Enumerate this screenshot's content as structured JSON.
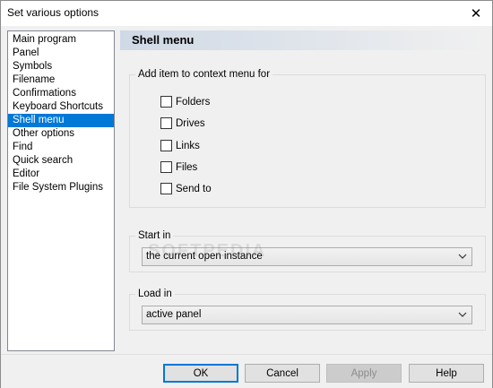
{
  "window": {
    "title": "Set various options"
  },
  "nav": {
    "items": [
      "Main program",
      "Panel",
      "Symbols",
      "Filename",
      "Confirmations",
      "Keyboard Shortcuts",
      "Shell menu",
      "Other options",
      "Find",
      "Quick search",
      "Editor",
      "File System Plugins"
    ],
    "selected": "Shell menu"
  },
  "panel": {
    "title": "Shell menu"
  },
  "context_group": {
    "legend": "Add  item to context menu for",
    "options": [
      {
        "label": "Folders",
        "checked": false
      },
      {
        "label": "Drives",
        "checked": false
      },
      {
        "label": "Links",
        "checked": false
      },
      {
        "label": "Files",
        "checked": false
      },
      {
        "label": "Send to",
        "checked": false
      }
    ]
  },
  "start_in": {
    "legend": "Start in",
    "value": "the current open instance"
  },
  "load_in": {
    "legend": "Load in",
    "value": "active panel"
  },
  "buttons": {
    "ok": "OK",
    "cancel": "Cancel",
    "apply": "Apply",
    "help": "Help"
  },
  "watermark": "SOFTPEDIA"
}
